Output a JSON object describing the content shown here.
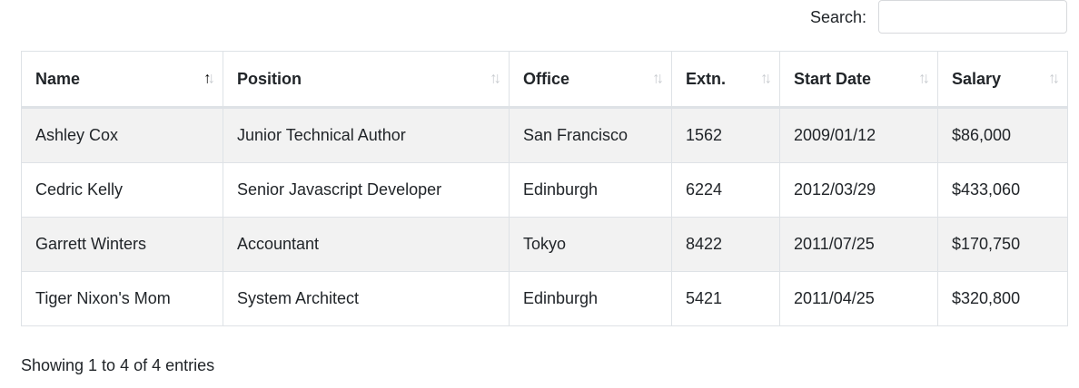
{
  "search": {
    "label": "Search:",
    "value": "",
    "placeholder": ""
  },
  "table": {
    "columns": [
      {
        "label": "Name",
        "sort": "asc"
      },
      {
        "label": "Position",
        "sort": "none"
      },
      {
        "label": "Office",
        "sort": "none"
      },
      {
        "label": "Extn.",
        "sort": "none"
      },
      {
        "label": "Start Date",
        "sort": "none"
      },
      {
        "label": "Salary",
        "sort": "none"
      }
    ],
    "rows": [
      [
        "Ashley Cox",
        "Junior Technical Author",
        "San Francisco",
        "1562",
        "2009/01/12",
        "$86,000"
      ],
      [
        "Cedric Kelly",
        "Senior Javascript Developer",
        "Edinburgh",
        "6224",
        "2012/03/29",
        "$433,060"
      ],
      [
        "Garrett Winters",
        "Accountant",
        "Tokyo",
        "8422",
        "2011/07/25",
        "$170,750"
      ],
      [
        "Tiger Nixon's Mom",
        "System Architect",
        "Edinburgh",
        "5421",
        "2011/04/25",
        "$320,800"
      ]
    ]
  },
  "info": {
    "text": "Showing 1 to 4 of 4 entries"
  },
  "colors": {
    "stripe": "#f2f2f2",
    "border": "#dee2e6",
    "sort_inactive": "#c8cbcf",
    "sort_active": "#000000"
  },
  "icons": {
    "sort": "sort-arrows-icon"
  }
}
